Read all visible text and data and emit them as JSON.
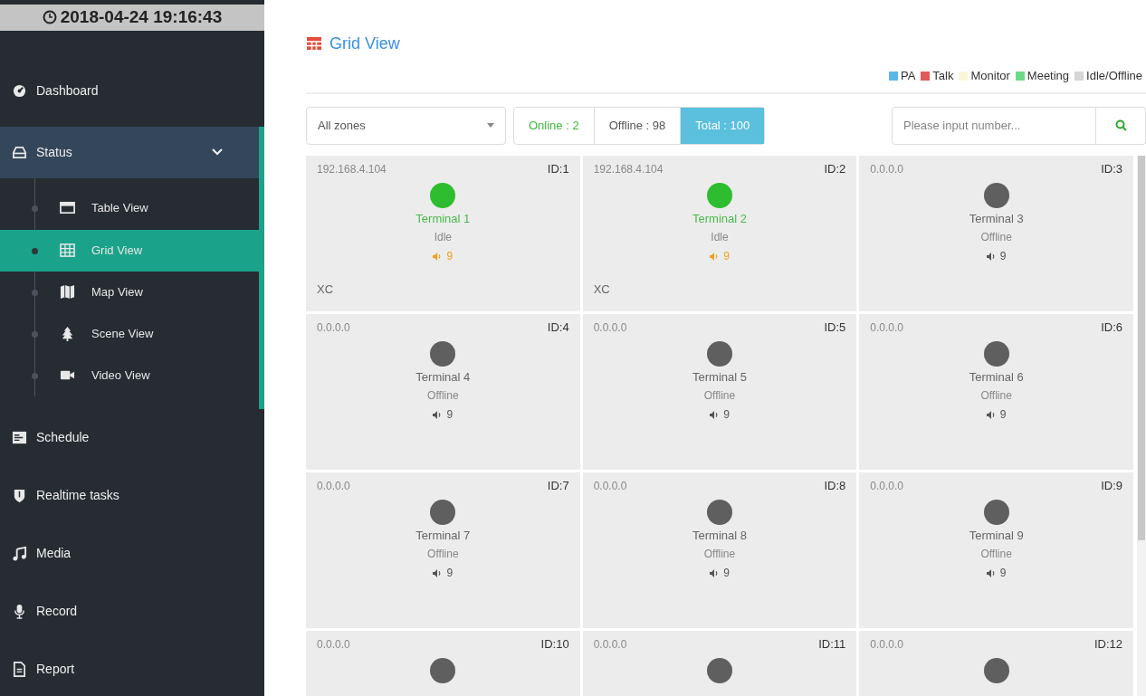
{
  "clock": {
    "time": "2018-04-24 19:16:43"
  },
  "sidebar": {
    "items": [
      {
        "label": "Dashboard",
        "selected": false
      },
      {
        "label": "Status",
        "selected": false,
        "expanded": true,
        "children": [
          {
            "label": "Table View",
            "selected": false
          },
          {
            "label": "Grid View",
            "selected": true
          },
          {
            "label": "Map View",
            "selected": false
          },
          {
            "label": "Scene View",
            "selected": false
          },
          {
            "label": "Video View",
            "selected": false
          }
        ]
      },
      {
        "label": "Schedule",
        "selected": false
      },
      {
        "label": "Realtime tasks",
        "selected": false
      },
      {
        "label": "Media",
        "selected": false
      },
      {
        "label": "Record",
        "selected": false
      },
      {
        "label": "Report",
        "selected": false
      }
    ]
  },
  "page": {
    "title": "Grid View"
  },
  "legend": [
    {
      "label": "PA",
      "color": "#5bb8e6"
    },
    {
      "label": "Talk",
      "color": "#e05a5a"
    },
    {
      "label": "Monitor",
      "color": "#fbf6d6"
    },
    {
      "label": "Meeting",
      "color": "#6fd98a"
    },
    {
      "label": "Idle/Offline",
      "color": "#d6d6d6"
    }
  ],
  "toolbar": {
    "zone_select": "All zones",
    "counts": [
      {
        "kind": "online",
        "label": "Online : 2",
        "selected": false
      },
      {
        "kind": "offline",
        "label": "Offline : 98",
        "selected": false
      },
      {
        "kind": "total",
        "label": "Total : 100",
        "selected": true
      }
    ],
    "search": {
      "placeholder": "Please input number..."
    }
  },
  "terminals": [
    {
      "ip": "192.168.4.104",
      "id": "ID:1",
      "online": true,
      "name": "Terminal 1",
      "status": "Idle",
      "volume": "9",
      "zone": "XC"
    },
    {
      "ip": "192.168.4.104",
      "id": "ID:2",
      "online": true,
      "name": "Terminal 2",
      "status": "Idle",
      "volume": "9",
      "zone": "XC"
    },
    {
      "ip": "0.0.0.0",
      "id": "ID:3",
      "online": false,
      "name": "Terminal 3",
      "status": "Offline",
      "volume": "9"
    },
    {
      "ip": "0.0.0.0",
      "id": "ID:4",
      "online": false,
      "name": "Terminal 4",
      "status": "Offline",
      "volume": "9"
    },
    {
      "ip": "0.0.0.0",
      "id": "ID:5",
      "online": false,
      "name": "Terminal 5",
      "status": "Offline",
      "volume": "9"
    },
    {
      "ip": "0.0.0.0",
      "id": "ID:6",
      "online": false,
      "name": "Terminal 6",
      "status": "Offline",
      "volume": "9"
    },
    {
      "ip": "0.0.0.0",
      "id": "ID:7",
      "online": false,
      "name": "Terminal 7",
      "status": "Offline",
      "volume": "9"
    },
    {
      "ip": "0.0.0.0",
      "id": "ID:8",
      "online": false,
      "name": "Terminal 8",
      "status": "Offline",
      "volume": "9"
    },
    {
      "ip": "0.0.0.0",
      "id": "ID:9",
      "online": false,
      "name": "Terminal 9",
      "status": "Offline",
      "volume": "9"
    },
    {
      "ip": "0.0.0.0",
      "id": "ID:10",
      "online": false
    },
    {
      "ip": "0.0.0.0",
      "id": "ID:11",
      "online": false
    },
    {
      "ip": "0.0.0.0",
      "id": "ID:12",
      "online": false
    }
  ]
}
